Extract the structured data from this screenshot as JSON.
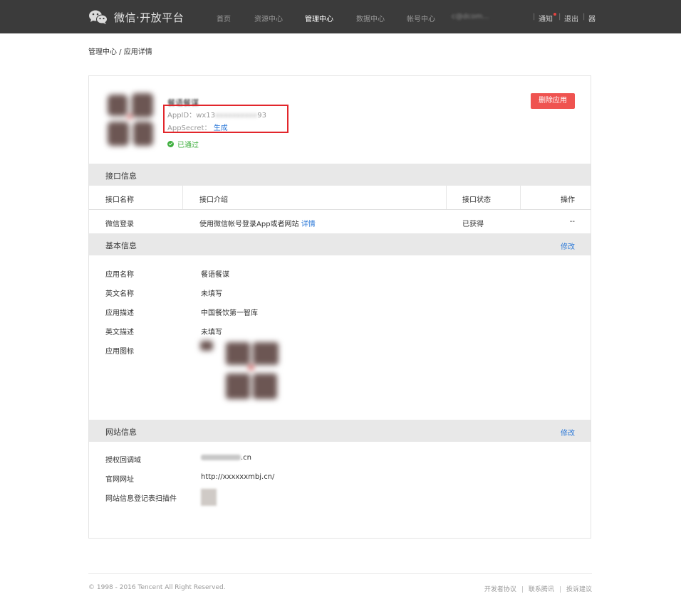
{
  "topbar": {
    "logo_text": "微信·开放平台",
    "nav": [
      {
        "label": "首页",
        "active": false
      },
      {
        "label": "资源中心",
        "active": false
      },
      {
        "label": "管理中心",
        "active": true
      },
      {
        "label": "数据中心",
        "active": false
      },
      {
        "label": "帐号中心",
        "active": false
      }
    ],
    "email": "c@dcom...",
    "notice_label": "通知",
    "logout_label": "退出",
    "qr_label": "器"
  },
  "breadcrumb": "管理中心 / 应用详情",
  "app": {
    "name": "餐语餐谋",
    "appid_label": "AppID：",
    "appid_prefix": "wx13",
    "appid_masked": "xxxxxxxxxx",
    "appid_suffix": "93",
    "appsecret_label": "AppSecret：",
    "appsecret_action": "生成",
    "status": "已通过",
    "delete_button": "删除应用"
  },
  "interface_section": {
    "title": "接口信息",
    "columns": [
      "接口名称",
      "接口介绍",
      "接口状态",
      "操作"
    ],
    "rows": [
      {
        "name": "微信登录",
        "desc": "使用微信帐号登录App或者网站",
        "detail_link": "详情",
        "status": "已获得",
        "action": "--"
      }
    ]
  },
  "basic_section": {
    "title": "基本信息",
    "edit": "修改",
    "rows": [
      {
        "label": "应用名称",
        "value": "餐语餐谋"
      },
      {
        "label": "英文名称",
        "value": "未填写"
      },
      {
        "label": "应用描述",
        "value": "中国餐饮第一智库"
      },
      {
        "label": "英文描述",
        "value": "未填写"
      },
      {
        "label": "应用图标",
        "value": ""
      }
    ]
  },
  "website_section": {
    "title": "网站信息",
    "edit": "修改",
    "rows": [
      {
        "label": "授权回调域",
        "value": ".cn"
      },
      {
        "label": "官网网址",
        "value": "http://xxxxxxmbj.cn/"
      },
      {
        "label": "网站信息登记表扫描件",
        "value": ""
      }
    ]
  },
  "footer": {
    "copyright": "© 1998 - 2016 Tencent All Right Reserved.",
    "links": [
      "开发者协议",
      "联系腾讯",
      "投诉建议"
    ]
  },
  "colors": {
    "topbar_bg": "#3b3b3b",
    "link": "#2e7ad8",
    "delete_button": "#ef5350",
    "status_ok": "#3faf3f",
    "highlight": "#e2262b"
  }
}
